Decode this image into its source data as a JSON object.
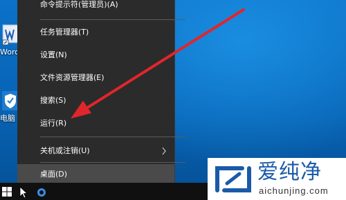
{
  "colors": {
    "menu_bg": "#2b2b2b",
    "menu_highlight": "#4a4a4a",
    "desktop": "#0a6fc4",
    "taskbar": "#101010",
    "arrow": "#e0262b",
    "logo_text": "#1a5aa8"
  },
  "desktop_icons": [
    {
      "label": "Word",
      "icon": "word-app-icon"
    },
    {
      "label": "电脑",
      "icon": "security-shield-icon"
    }
  ],
  "context_menu": {
    "items": [
      {
        "label": "命令提示符(管理员)(A)"
      },
      {
        "label": "任务管理器(T)"
      },
      {
        "label": "设置(N)"
      },
      {
        "label": "文件资源管理器(E)"
      },
      {
        "label": "搜索(S)"
      },
      {
        "label": "运行(R)"
      },
      {
        "label": "关机或注销(U)",
        "submenu_icon": "chevron-right-icon"
      },
      {
        "label": "桌面(D)",
        "highlighted": true
      }
    ]
  },
  "taskbar": {
    "start_icon": "windows-start-icon"
  },
  "annotation": {
    "type": "red-arrow",
    "points_to": "运行(R)"
  },
  "watermark": {
    "chinese": "爱纯净",
    "url": "aichunjing.com"
  }
}
